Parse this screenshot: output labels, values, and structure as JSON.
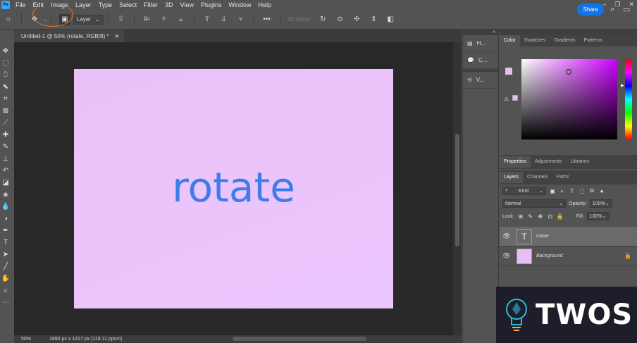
{
  "menubar": {
    "logo": "Ps",
    "items": [
      "File",
      "Edit",
      "Image",
      "Layer",
      "Type",
      "Select",
      "Filter",
      "3D",
      "View",
      "Plugins",
      "Window",
      "Help"
    ]
  },
  "options": {
    "auto_select_value": "Layer",
    "threed_mode": "3D Mode:",
    "share_label": "Share"
  },
  "document": {
    "tab_title": "Untitled-1 @ 50% (rotate, RGB/8) *",
    "canvas_text": "rotate",
    "canvas_color": "#ebc4fb",
    "text_color": "#3c7dea"
  },
  "status": {
    "zoom": "50%",
    "info": "1890 px x 1417 px (118.11 ppcm)"
  },
  "collapsed_panels": [
    {
      "icon": "history-icon",
      "label": "H..."
    },
    {
      "icon": "comments-icon",
      "label": "C..."
    },
    {
      "icon": "versions-icon",
      "label": "V..."
    }
  ],
  "color_panel": {
    "tabs": [
      "Color",
      "Swatches",
      "Gradients",
      "Patterns"
    ],
    "foreground": "#e6bdf5"
  },
  "properties_tabs": [
    "Properties",
    "Adjustments",
    "Libraries"
  ],
  "layers_panel": {
    "tabs": [
      "Layers",
      "Channels",
      "Paths"
    ],
    "filter_kind": "Kind",
    "blend_mode": "Normal",
    "opacity_label": "Opacity:",
    "opacity_value": "100%",
    "lock_label": "Lock:",
    "fill_label": "Fill:",
    "fill_value": "100%",
    "layers": [
      {
        "name": "rotate",
        "thumb": "T"
      },
      {
        "name": "Background",
        "thumb": ""
      }
    ]
  },
  "watermark": {
    "text": "TWOS"
  }
}
